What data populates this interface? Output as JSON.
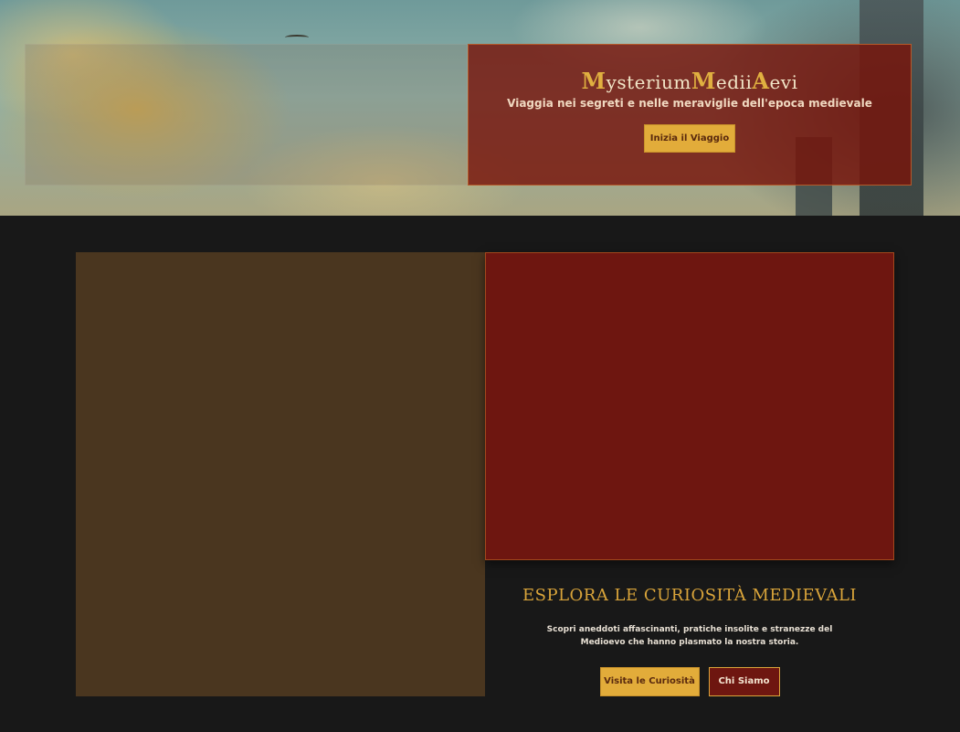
{
  "hero": {
    "title_parts": [
      {
        "initial": "M",
        "rest": "ysterium"
      },
      {
        "initial": "M",
        "rest": "edii"
      },
      {
        "initial": "A",
        "rest": "evi"
      }
    ],
    "subtitle": "Viaggia nei segreti e nelle meraviglie dell'epoca medievale",
    "cta_label": "Inizia il Viaggio"
  },
  "section": {
    "title": "ESPLORA LE CURIOSITÀ MEDIEVALI",
    "description": "Scopri aneddoti affascinanti, pratiche insolite e stranezze del Medioevo che hanno plasmato la nostra storia.",
    "primary_button": "Visita le Curiosità",
    "secondary_button": "Chi Siamo"
  },
  "colors": {
    "accent_gold": "#e2ac3a",
    "deep_red": "#6e1610",
    "brown": "#4a361f",
    "background": "#181818"
  }
}
